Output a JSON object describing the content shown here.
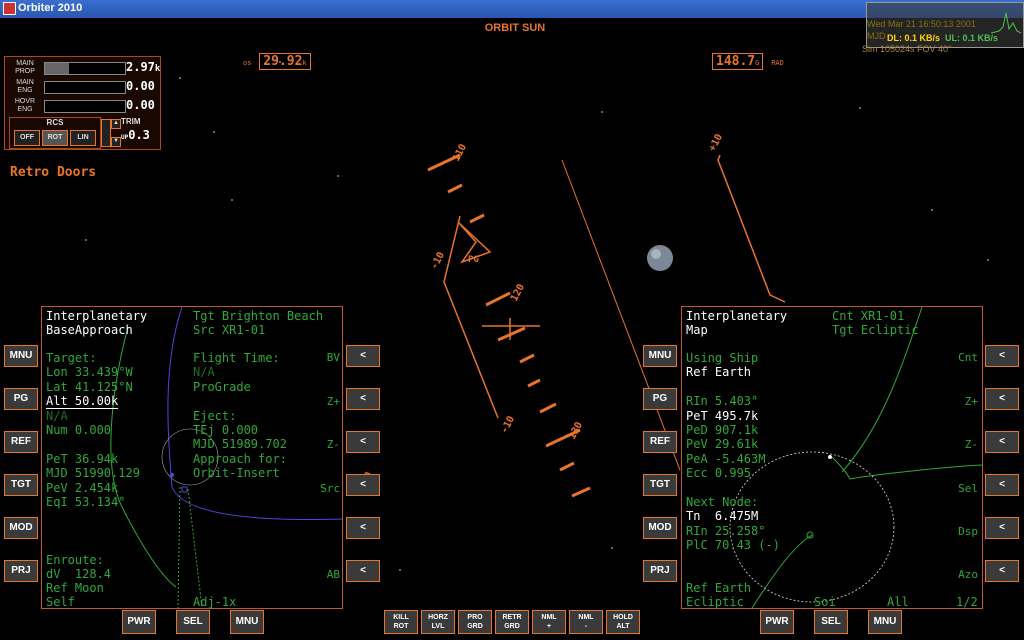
{
  "window": {
    "title": "Orbiter 2010"
  },
  "hud": {
    "mode": "ORBIT SUN",
    "os_label": "os",
    "os_value": "29.92",
    "os_unit": "k",
    "rad_value": "148.7",
    "rad_unit": "G",
    "rad_label": "RAD",
    "ladder": [
      "110",
      "-10",
      "120",
      "-10",
      "130",
      "+10",
      "-20"
    ],
    "pg_marker": "PG"
  },
  "engine_panel": {
    "rows": [
      {
        "label": "MAIN PROP",
        "value": "2.97",
        "unit": "k",
        "fill": 0.3
      },
      {
        "label": "MAIN ENG",
        "value": "0.00",
        "unit": "",
        "fill": 0
      },
      {
        "label": "HOVR ENG",
        "value": "0.00",
        "unit": "",
        "fill": 0
      }
    ],
    "rcs": {
      "label": "RCS",
      "buttons": [
        "OFF",
        "ROT",
        "LIN"
      ],
      "active": "ROT"
    },
    "trim": {
      "label": "TRIM",
      "prefix": "UP",
      "value": "0.3"
    }
  },
  "status_message": "Retro Doors",
  "net_overlay": {
    "ghost_line1": "Wed Mar 21 16:50:13 2001",
    "ghost_line2": "MJD",
    "dl": "DL: 0.1 KB/s",
    "ul": "UL: 0.1 KB/s",
    "ghost_line3": "Sim   105024s        FOV  40°"
  },
  "left_mfd": {
    "header": [
      "Interplanetary",
      "BaseApproach"
    ],
    "tgt_line": "Tgt Brighton Beach",
    "src_line": "Src XR1-01",
    "lines_left": [
      {
        "t": "Target:",
        "c": "g"
      },
      {
        "t": "Lon 33.439°W",
        "c": "g"
      },
      {
        "t": "Lat 41.125°N",
        "c": "g"
      },
      {
        "t": "Alt 50.00k",
        "c": "w"
      },
      {
        "t": "N/A",
        "c": "dim"
      },
      {
        "t": "Num 0.000",
        "c": "g"
      },
      {
        "t": "",
        "c": "g"
      },
      {
        "t": "PeT 36.94k",
        "c": "g"
      },
      {
        "t": "MJD 51990.129",
        "c": "g"
      },
      {
        "t": "PeV 2.454k",
        "c": "g"
      },
      {
        "t": "EqI 53.134°",
        "c": "g"
      }
    ],
    "lines_right": [
      {
        "t": "Flight Time:",
        "c": "g"
      },
      {
        "t": "N/A",
        "c": "dim"
      },
      {
        "t": "ProGrade",
        "c": "g"
      },
      {
        "t": "",
        "c": "g"
      },
      {
        "t": "Eject:",
        "c": "g"
      },
      {
        "t": "TEj 0.000",
        "c": "g"
      },
      {
        "t": "MJD 51989.702",
        "c": "g"
      },
      {
        "t": "Approach for:",
        "c": "g"
      },
      {
        "t": "Orbit-Insert",
        "c": "g"
      }
    ],
    "footer_left": [
      "Enroute:",
      "dV  128.4",
      "Ref Moon",
      "Self"
    ],
    "footer_right": "Adj-1x",
    "softkeys": [
      "BV",
      "Z+",
      "Z-",
      "Src",
      "",
      "AB"
    ]
  },
  "right_mfd": {
    "header": [
      "Interplanetary",
      "Map"
    ],
    "cnt_line": "Cnt XR1-01",
    "tgt_line": "Tgt Ecliptic",
    "lines": [
      {
        "t": "Using Ship",
        "c": "g"
      },
      {
        "t": "Ref Earth",
        "c": "w"
      },
      {
        "t": "",
        "c": "g"
      },
      {
        "t": "RIn 5.403°",
        "c": "g"
      },
      {
        "t": "PeT 495.7k",
        "c": "w"
      },
      {
        "t": "PeD 907.1k",
        "c": "g"
      },
      {
        "t": "PeV 29.61k",
        "c": "g"
      },
      {
        "t": "PeA -5.463M",
        "c": "g"
      },
      {
        "t": "Ecc 0.995",
        "c": "g"
      },
      {
        "t": "",
        "c": "g"
      },
      {
        "t": "Next Node:",
        "c": "g"
      },
      {
        "t": "Tn  6.475M",
        "c": "w"
      },
      {
        "t": "RIn 25.258°",
        "c": "g"
      },
      {
        "t": "PlC 70.43 (-)",
        "c": "g"
      }
    ],
    "footer": [
      "Ref Earth",
      "Ecliptic"
    ],
    "footer_soi": "Soi",
    "footer_all": "All",
    "page": "1/2",
    "softkeys": [
      "Cnt",
      "Z+",
      "Z-",
      "Sel",
      "Dsp",
      "Azo"
    ]
  },
  "side_buttons": [
    "MNU",
    "PG",
    "REF",
    "TGT",
    "MOD",
    "PRJ"
  ],
  "arrow_glyph": "<",
  "bottom_left": [
    "PWR",
    "SEL",
    "MNU"
  ],
  "bottom_right": [
    "PWR",
    "SEL",
    "MNU"
  ],
  "autopilot": [
    [
      "KILL",
      "ROT"
    ],
    [
      "HORZ",
      "LVL"
    ],
    [
      "PRO",
      "GRD"
    ],
    [
      "RETR",
      "GRD"
    ],
    [
      "NML",
      "+"
    ],
    [
      "NML",
      "-"
    ],
    [
      "HOLD",
      "ALT"
    ]
  ]
}
